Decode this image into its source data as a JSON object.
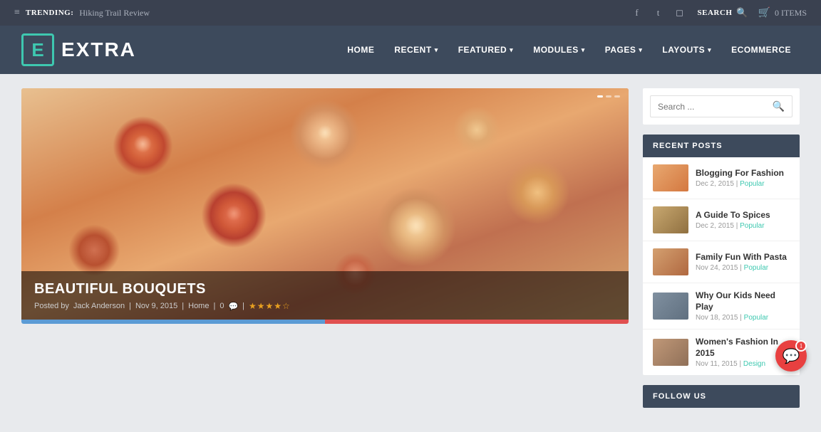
{
  "topbar": {
    "hamburger": "≡",
    "trending_label": "TRENDING:",
    "trending_link": "Hiking Trail Review",
    "search_label": "SEARCH",
    "cart_count": "0 ITEMS"
  },
  "header": {
    "logo_letter": "E",
    "logo_text": "EXTRA",
    "nav_items": [
      {
        "label": "HOME",
        "has_arrow": false
      },
      {
        "label": "RECENT",
        "has_arrow": true
      },
      {
        "label": "FEATURED",
        "has_arrow": true
      },
      {
        "label": "MODULES",
        "has_arrow": true
      },
      {
        "label": "PAGES",
        "has_arrow": true
      },
      {
        "label": "LAYOUTS",
        "has_arrow": true
      },
      {
        "label": "ECOMMERCE",
        "has_arrow": false
      }
    ]
  },
  "hero": {
    "title": "BEAUTIFUL BOUQUETS",
    "meta_posted": "Posted by",
    "author": "Jack Anderson",
    "date": "Nov 9, 2015",
    "category": "Home",
    "comments": "0",
    "stars": "★★★★☆"
  },
  "search_widget": {
    "placeholder": "Search ..."
  },
  "recent_posts": {
    "header": "RECENT POSTS",
    "posts": [
      {
        "title": "Blogging For Fashion",
        "date": "Dec 2, 2015",
        "tag": "Popular",
        "thumb_class": "thumb-1"
      },
      {
        "title": "A Guide To Spices",
        "date": "Dec 2, 2015",
        "tag": "Popular",
        "thumb_class": "thumb-2"
      },
      {
        "title": "Family Fun With Pasta",
        "date": "Nov 24, 2015",
        "tag": "Popular",
        "thumb_class": "thumb-3"
      },
      {
        "title": "Why Our Kids Need Play",
        "date": "Nov 18, 2015",
        "tag": "Popular",
        "thumb_class": "thumb-4"
      },
      {
        "title": "Women's Fashion In 2015",
        "date": "Nov 11, 2015",
        "tag": "Design",
        "thumb_class": "thumb-5"
      }
    ]
  },
  "follow_us": {
    "header": "FOLLOW US"
  },
  "chat": {
    "badge": "1"
  },
  "colors": {
    "accent": "#3ec8b0",
    "nav_bg": "#3d4a5c",
    "topbar_bg": "#3a4150"
  }
}
